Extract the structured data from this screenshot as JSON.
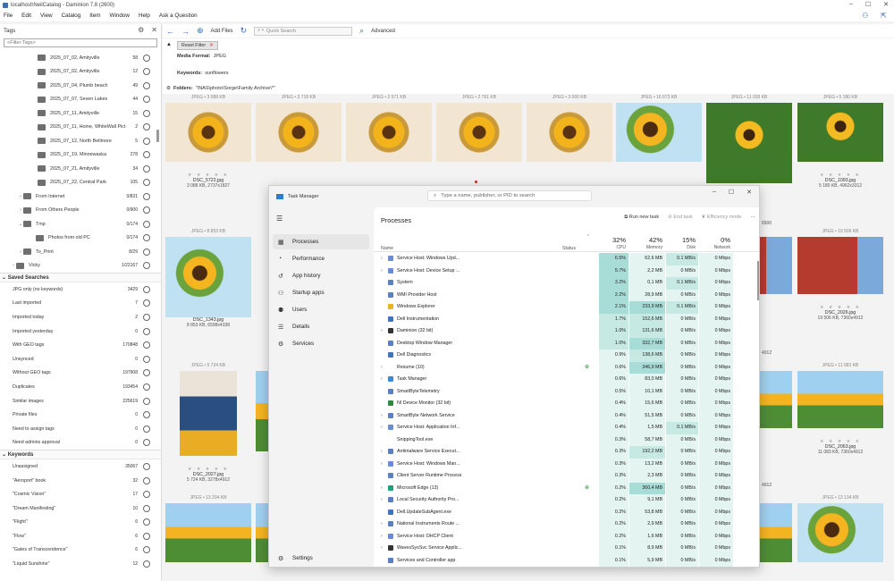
{
  "app": {
    "title": "localhost\\NeilCatalog - Daminion 7.8 (2600)",
    "menu": [
      "File",
      "Edit",
      "View",
      "Catalog",
      "Item",
      "Window",
      "Help",
      "Ask a Question"
    ]
  },
  "tags_panel": {
    "title": "Tags",
    "filter_placeholder": "<Filter Tags>",
    "folders": [
      {
        "label": "2025_07_02, Amityville",
        "count": "58"
      },
      {
        "label": "2025_07_02, Amityville",
        "count": "12"
      },
      {
        "label": "2025_07_04, Plumb beach",
        "count": "49"
      },
      {
        "label": "2025_07_07, Seven Lakes",
        "count": "44"
      },
      {
        "label": "2025_07_11, Amityville",
        "count": "15"
      },
      {
        "label": "2025_07_11, Home, WhiteWall Pict",
        "count": "2"
      },
      {
        "label": "2025_07_12, North Bellmore",
        "count": "5"
      },
      {
        "label": "2025_07_19, Minnewaska",
        "count": "278"
      },
      {
        "label": "2025_07_21, Amityville",
        "count": "34"
      },
      {
        "label": "2025_07_22, Central Park",
        "count": "105"
      }
    ],
    "groups": [
      {
        "label": "From Internet",
        "count": "0/831",
        "arrow": "›",
        "indent": 20
      },
      {
        "label": "From Others People",
        "count": "0/900",
        "arrow": "›",
        "indent": 20
      },
      {
        "label": "Tmp",
        "count": "0/174",
        "arrow": "⌄",
        "indent": 20
      },
      {
        "label": "Photos from old PC",
        "count": "0/174",
        "arrow": "",
        "indent": 34
      },
      {
        "label": "To_Print",
        "count": "8/29",
        "arrow": "›",
        "indent": 20
      },
      {
        "label": "Vicky",
        "count": "1/22167",
        "arrow": "›",
        "indent": 12
      }
    ]
  },
  "saved_searches": {
    "title": "Saved Searches",
    "items": [
      {
        "label": "JPG only (no keywords)",
        "count": "3429"
      },
      {
        "label": "Last imported",
        "count": "7"
      },
      {
        "label": "Imported today",
        "count": "2"
      },
      {
        "label": "Imported yesterday",
        "count": "0"
      },
      {
        "label": "With GEO tags",
        "count": "170848"
      },
      {
        "label": "Unsynced",
        "count": "0"
      },
      {
        "label": "Without GEO tags",
        "count": "197908"
      },
      {
        "label": "Duplicates",
        "count": "193454"
      },
      {
        "label": "Similar images",
        "count": "225619"
      },
      {
        "label": "Private files",
        "count": "0"
      },
      {
        "label": "Need to assign tags",
        "count": "0"
      },
      {
        "label": "Need admins approval",
        "count": "0"
      }
    ]
  },
  "keywords": {
    "title": "Keywords",
    "items": [
      {
        "label": "Unassigned",
        "count": "35067"
      },
      {
        "label": "\"Aeroport\" book",
        "count": "32"
      },
      {
        "label": "\"Cosmic Vision\"",
        "count": "17"
      },
      {
        "label": "\"Dream Manifesting\"",
        "count": "10"
      },
      {
        "label": "\"Flight\"",
        "count": "6"
      },
      {
        "label": "\"Flow\"",
        "count": "6"
      },
      {
        "label": "\"Gates of Transcendence\"",
        "count": "6"
      },
      {
        "label": "\"Liquid Sunshine\"",
        "count": "12"
      }
    ]
  },
  "toolbar": {
    "add_files": "Add Files",
    "search_placeholder": "Quick Search",
    "advanced": "Advanced"
  },
  "filter_area": {
    "reset": "Reset Filter",
    "media_format_label": "Media Format:",
    "media_format_value": "JPEG",
    "keywords_label": "Keywords:",
    "keywords_value": "sunflowers",
    "folders_label": "Folders:",
    "folders_value": "\"\\NAS\\photo\\Sorge\\Family Archive\\*\""
  },
  "thumbnails": {
    "row1_meta": [
      "JPEG • 3 088 KB",
      "JPEG • 3 718 KB",
      "JPEG • 2 571 KB",
      "JPEG • 2 761 KB",
      "JPEG • 3 000 KB",
      "JPEG • 16 873 KB",
      "JPEG • 11 028 KB",
      "JPEG • 5 180 KB"
    ],
    "row2_meta": [
      "JPEG • 8 853 KB",
      "JPEG • 19 506 KB"
    ],
    "row3_meta": [
      "JPEG • 5 724 KB",
      "JPEG • 11 083 KB"
    ],
    "row4_meta": [
      "JPEG • 13 204 KB",
      "JPEG • 13 134 KB"
    ],
    "captions": [
      {
        "name": "DSC_5722.jpg",
        "dim": "3 088 KB, 2737x1827"
      },
      {
        "name": "DSC_1093.jpg",
        "dim": "5 180 KB, 4962x3312"
      },
      {
        "name": "DSC_1343.jpg",
        "dim": "8 853 KB, 6598x4338"
      },
      {
        "name": "DSC_2026.jpg",
        "dim": "19 506 KB, 7360x4912"
      },
      {
        "name": "DSC_2027.jpg",
        "dim": "5 724 KB, 3278x4912"
      },
      {
        "name": "DSC_2063.jpg",
        "dim": "11 083 KB, 7360x4912"
      }
    ],
    "partial_caption_1": "6500",
    "partial_caption_2": "4912",
    "partial_caption_3": "4912",
    "stars": "★ ★ ★ ★ ★"
  },
  "task_manager": {
    "title": "Task Manager",
    "search_placeholder": "Type a name, publisher, or PID to search",
    "nav": [
      {
        "label": "Processes",
        "icon": "▦"
      },
      {
        "label": "Performance",
        "icon": "◔"
      },
      {
        "label": "App history",
        "icon": "↺"
      },
      {
        "label": "Startup apps",
        "icon": "⚇"
      },
      {
        "label": "Users",
        "icon": "⚉"
      },
      {
        "label": "Details",
        "icon": "☰"
      },
      {
        "label": "Services",
        "icon": "⚙"
      }
    ],
    "settings": "Settings",
    "page_title": "Processes",
    "actions": {
      "run": "Run new task",
      "end": "End task",
      "eff": "Efficiency mode"
    },
    "columns": {
      "name": "Name",
      "status": "Status",
      "cpu_pct": "32%",
      "cpu": "CPU",
      "mem_pct": "42%",
      "mem": "Memory",
      "disk_pct": "15%",
      "disk": "Disk",
      "net_pct": "0%",
      "net": "Network"
    },
    "processes": [
      {
        "name": "Service Host: Windows Upd...",
        "exp": true,
        "icon": "#6a8bd8",
        "cpu": "6.5%",
        "mem": "62,6 MB",
        "disk": "0.1 MB/s",
        "net": "0 Mbps",
        "status": ""
      },
      {
        "name": "Service Host: Device Setup ...",
        "exp": true,
        "icon": "#6a8bd8",
        "cpu": "5.7%",
        "mem": "2,2 MB",
        "disk": "0 MB/s",
        "net": "0 Mbps",
        "status": ""
      },
      {
        "name": "System",
        "exp": false,
        "icon": "#5b7fc4",
        "cpu": "3.2%",
        "mem": "0,1 MB",
        "disk": "0.1 MB/s",
        "net": "0 Mbps",
        "status": ""
      },
      {
        "name": "WMI Provider Host",
        "exp": false,
        "icon": "#5b7fc4",
        "cpu": "2.2%",
        "mem": "28,9 MB",
        "disk": "0 MB/s",
        "net": "0 Mbps",
        "status": ""
      },
      {
        "name": "Windows Explorer",
        "exp": false,
        "icon": "#e8b423",
        "cpu": "2.1%",
        "mem": "233,9 MB",
        "disk": "0.1 MB/s",
        "net": "0 Mbps",
        "status": ""
      },
      {
        "name": "Dell Instrumentation",
        "exp": false,
        "icon": "#3b74c6",
        "cpu": "1.7%",
        "mem": "152,6 MB",
        "disk": "0 MB/s",
        "net": "0 Mbps",
        "status": ""
      },
      {
        "name": "Daminion (32 bit)",
        "exp": true,
        "icon": "#333333",
        "cpu": "1.0%",
        "mem": "131,6 MB",
        "disk": "0 MB/s",
        "net": "0 Mbps",
        "status": ""
      },
      {
        "name": "Desktop Window Manager",
        "exp": false,
        "icon": "#5b7fc4",
        "cpu": "1.0%",
        "mem": "332,7 MB",
        "disk": "0 MB/s",
        "net": "0 Mbps",
        "status": ""
      },
      {
        "name": "Dell Diagnostics",
        "exp": false,
        "icon": "#3b74c6",
        "cpu": "0.9%",
        "mem": "138,6 MB",
        "disk": "0 MB/s",
        "net": "0 Mbps",
        "status": ""
      },
      {
        "name": "Resume (10)",
        "exp": true,
        "icon": "",
        "cpu": "0.6%",
        "mem": "346,9 MB",
        "disk": "0 MB/s",
        "net": "0 Mbps",
        "status": "⊕"
      },
      {
        "name": "Task Manager",
        "exp": true,
        "icon": "#3b8ad9",
        "cpu": "0.6%",
        "mem": "83,0 MB",
        "disk": "0 MB/s",
        "net": "0 Mbps",
        "status": ""
      },
      {
        "name": "SmartByteTelemetry",
        "exp": false,
        "icon": "#5b7fc4",
        "cpu": "0.5%",
        "mem": "10,1 MB",
        "disk": "0 MB/s",
        "net": "0 Mbps",
        "status": ""
      },
      {
        "name": "NI Device Monitor (32 bit)",
        "exp": false,
        "icon": "#2d8a3e",
        "cpu": "0.4%",
        "mem": "15,6 MB",
        "disk": "0 MB/s",
        "net": "0 Mbps",
        "status": ""
      },
      {
        "name": "SmartByte Network Service",
        "exp": true,
        "icon": "#5b7fc4",
        "cpu": "0.4%",
        "mem": "51,5 MB",
        "disk": "0 MB/s",
        "net": "0 Mbps",
        "status": ""
      },
      {
        "name": "Service Host: Application Inf...",
        "exp": true,
        "icon": "#6a8bd8",
        "cpu": "0.4%",
        "mem": "1,5 MB",
        "disk": "0.1 MB/s",
        "net": "0 Mbps",
        "status": ""
      },
      {
        "name": "SnippingTool.exe",
        "exp": false,
        "icon": "",
        "cpu": "0.3%",
        "mem": "58,7 MB",
        "disk": "0 MB/s",
        "net": "0 Mbps",
        "status": ""
      },
      {
        "name": "Antimalware Service Execut...",
        "exp": true,
        "icon": "#5b7fc4",
        "cpu": "0.3%",
        "mem": "192,2 MB",
        "disk": "0 MB/s",
        "net": "0 Mbps",
        "status": ""
      },
      {
        "name": "Service Host: Windows Man...",
        "exp": true,
        "icon": "#6a8bd8",
        "cpu": "0.3%",
        "mem": "13,2 MB",
        "disk": "0 MB/s",
        "net": "0 Mbps",
        "status": ""
      },
      {
        "name": "Client Server Runtime Process",
        "exp": false,
        "icon": "#5b7fc4",
        "cpu": "0.3%",
        "mem": "2,3 MB",
        "disk": "0 MB/s",
        "net": "0 Mbps",
        "status": ""
      },
      {
        "name": "Microsoft Edge (13)",
        "exp": true,
        "icon": "#1f9e7a",
        "cpu": "0.2%",
        "mem": "360,4 MB",
        "disk": "0 MB/s",
        "net": "0 Mbps",
        "status": "⊕"
      },
      {
        "name": "Local Security Authority Pro...",
        "exp": true,
        "icon": "#5b7fc4",
        "cpu": "0.2%",
        "mem": "9,1 MB",
        "disk": "0 MB/s",
        "net": "0 Mbps",
        "status": ""
      },
      {
        "name": "Dell.UpdateSubAgent.exe",
        "exp": false,
        "icon": "#3b74c6",
        "cpu": "0.2%",
        "mem": "53,8 MB",
        "disk": "0 MB/s",
        "net": "0 Mbps",
        "status": ""
      },
      {
        "name": "National Instruments Route ...",
        "exp": true,
        "icon": "#5b7fc4",
        "cpu": "0.2%",
        "mem": "2,9 MB",
        "disk": "0 MB/s",
        "net": "0 Mbps",
        "status": ""
      },
      {
        "name": "Service Host: DHCP Client",
        "exp": true,
        "icon": "#6a8bd8",
        "cpu": "0.2%",
        "mem": "1,6 MB",
        "disk": "0 MB/s",
        "net": "0 Mbps",
        "status": ""
      },
      {
        "name": "WavesSysSvc Service Applic...",
        "exp": true,
        "icon": "#333333",
        "cpu": "0.1%",
        "mem": "8,9 MB",
        "disk": "0 MB/s",
        "net": "0 Mbps",
        "status": ""
      },
      {
        "name": "Services and Controller app",
        "exp": false,
        "icon": "#5b7fc4",
        "cpu": "0.1%",
        "mem": "5,9 MB",
        "disk": "0 MB/s",
        "net": "0 Mbps",
        "status": ""
      }
    ]
  },
  "colors": {
    "heat_high": "#a8dcd6",
    "heat_mid": "#c6e9e4",
    "heat_low": "#e3f4f1",
    "accent": "#2a6ad0"
  }
}
